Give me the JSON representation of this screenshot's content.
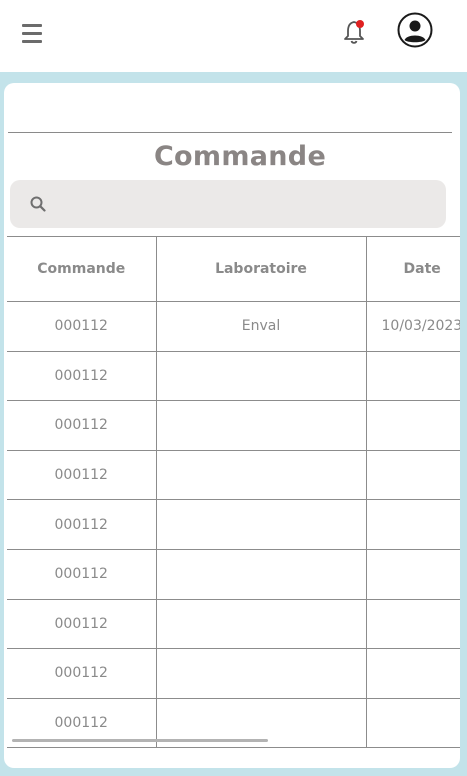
{
  "header": {
    "menu_icon": "hamburger-menu-icon",
    "notification_icon": "bell-icon",
    "notification_dot_color": "#e02020",
    "profile_icon": "user-avatar-icon"
  },
  "page": {
    "title": "Commande"
  },
  "search": {
    "icon": "search-icon",
    "value": "",
    "placeholder": ""
  },
  "table": {
    "columns": [
      "Commande",
      "Laboratoire",
      "Date"
    ],
    "rows": [
      {
        "commande": "000112",
        "laboratoire": "Enval",
        "date": "10/03/2023"
      },
      {
        "commande": "000112",
        "laboratoire": "",
        "date": ""
      },
      {
        "commande": "000112",
        "laboratoire": "",
        "date": ""
      },
      {
        "commande": "000112",
        "laboratoire": "",
        "date": ""
      },
      {
        "commande": "000112",
        "laboratoire": "",
        "date": ""
      },
      {
        "commande": "000112",
        "laboratoire": "",
        "date": ""
      },
      {
        "commande": "000112",
        "laboratoire": "",
        "date": ""
      },
      {
        "commande": "000112",
        "laboratoire": "",
        "date": ""
      },
      {
        "commande": "000112",
        "laboratoire": "",
        "date": ""
      }
    ]
  },
  "colors": {
    "page_background": "#c3e3ea",
    "title_text": "#8a8584",
    "table_text": "#8a8a8a",
    "search_background": "#ebe9e8"
  }
}
